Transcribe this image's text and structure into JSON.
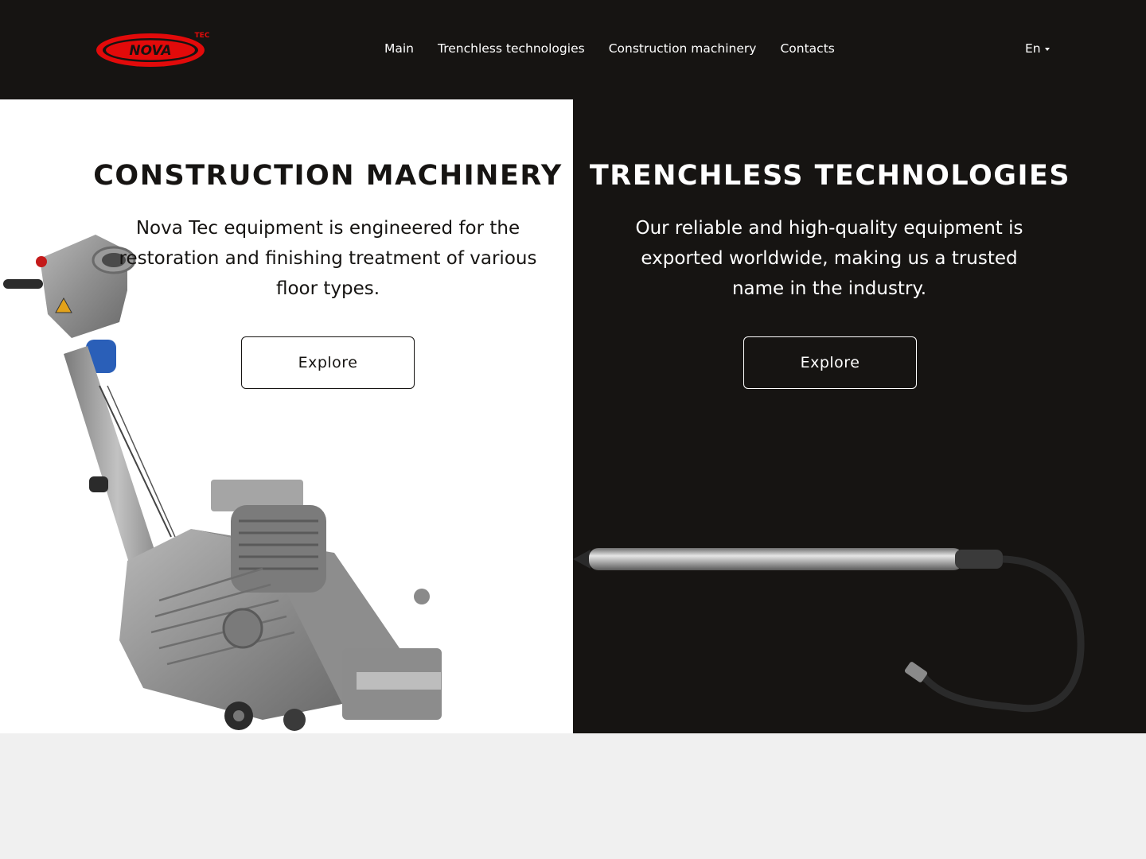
{
  "header": {
    "logo": {
      "text": "NOVA",
      "superscript": "TEC",
      "brand_color": "#e20a0a"
    },
    "nav": [
      {
        "label": "Main"
      },
      {
        "label": "Trenchless technologies"
      },
      {
        "label": "Construction machinery"
      },
      {
        "label": "Contacts"
      }
    ],
    "language": {
      "label": "En",
      "icon": "chevron-down-icon"
    }
  },
  "left_panel": {
    "title": "CONSTRUCTION MACHINERY",
    "description": "Nova Tec equipment is engineered for the restoration and finishing treatment of various floor types.",
    "button_label": "Explore",
    "image": "floor-sanding-machine"
  },
  "right_panel": {
    "title": "TRENCHLESS TECHNOLOGIES",
    "description": "Our reliable and high-quality equipment is exported worldwide, making us a trusted name in the industry.",
    "button_label": "Explore",
    "image": "pneumatic-piercing-tool-with-hose"
  },
  "colors": {
    "dark_background": "#161412",
    "light_background": "#ffffff",
    "page_background": "#f0f0f0",
    "text_light": "#ffffff",
    "text_dark": "#161412"
  }
}
